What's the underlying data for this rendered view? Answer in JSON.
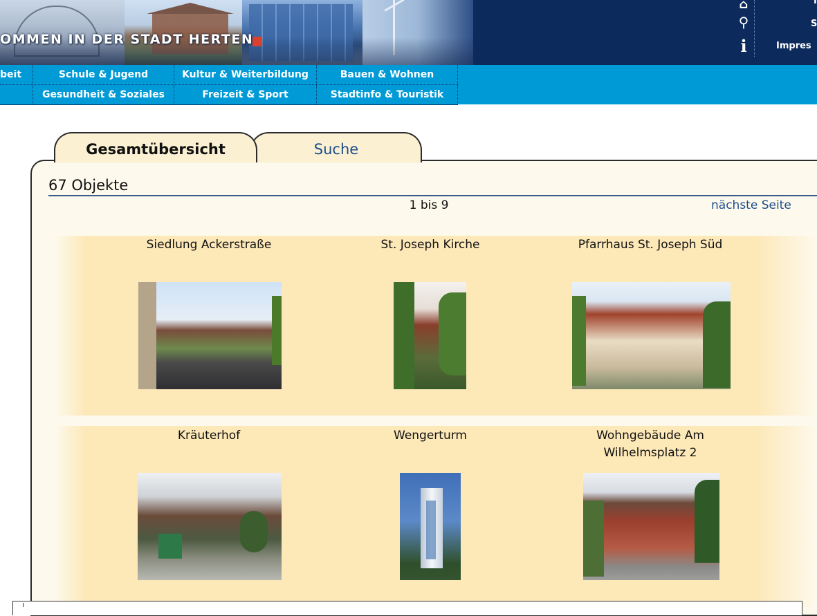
{
  "banner": {
    "title": "OMMEN IN DER STADT HERTEN",
    "utility_links": [
      "S",
      "Impres"
    ],
    "utility_icons": [
      "home-icon",
      "search-icon",
      "info-icon"
    ],
    "corner_letter": "I"
  },
  "nav": {
    "row1": [
      "beit",
      "Schule & Jugend",
      "Kultur & Weiterbildung",
      "Bauen & Wohnen"
    ],
    "row2": [
      "Gesundheit & Soziales",
      "Freizeit & Sport",
      "Stadtinfo & Touristik"
    ]
  },
  "tabs": {
    "overview": "Gesamtübersicht",
    "search": "Suche"
  },
  "results": {
    "count_title": "67  Objekte",
    "range": "1 bis 9",
    "next_page": "nächste Seite"
  },
  "items": [
    {
      "title": "Siedlung Ackerstraße",
      "image": "settlement-street-photo"
    },
    {
      "title": "St. Joseph Kirche",
      "image": "church-photo"
    },
    {
      "title": "Pfarrhaus St. Joseph Süd",
      "image": "parsonage-photo"
    },
    {
      "title": "Kräuterhof",
      "image": "herb-farm-photo"
    },
    {
      "title": "Wengerturm",
      "image": "tower-photo"
    },
    {
      "title_line1": "Wohngebäude Am",
      "title_line2": "Wilhelmsplatz 2",
      "image": "residential-building-photo"
    }
  ],
  "colors": {
    "banner_bg": "#0c2a5c",
    "nav_bg": "#009ad6",
    "panel_bg": "#fdf9ec",
    "tile_bg": "#fde8b8",
    "link": "#1b4d8c",
    "accent_red": "#d9402e"
  }
}
